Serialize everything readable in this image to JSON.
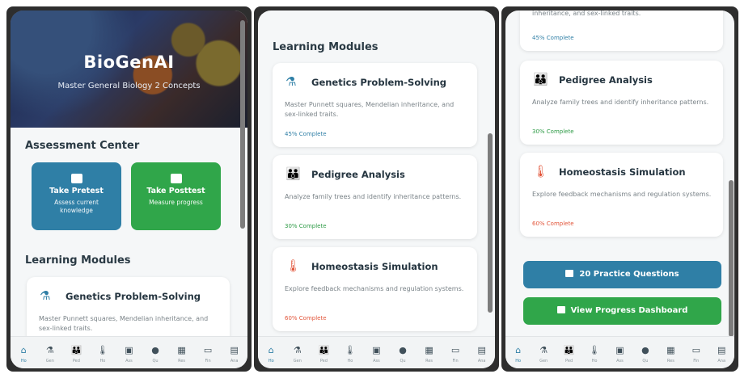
{
  "app": {
    "title": "BioGenAI",
    "subtitle": "Master General Biology 2 Concepts"
  },
  "assessment": {
    "section_title": "Assessment Center",
    "pretest": {
      "label": "Take Pretest",
      "desc": "Assess current knowledge"
    },
    "posttest": {
      "label": "Take Posttest",
      "desc": "Measure progress"
    }
  },
  "modules": {
    "section_title": "Learning Modules",
    "items": [
      {
        "icon": "microscope-icon",
        "title": "Genetics Problem-Solving",
        "desc": "Master Punnett squares, Mendelian inheritance, and sex-linked traits.",
        "progress": "45% Complete",
        "progress_value": 45,
        "color": "#2f7fa6"
      },
      {
        "icon": "family-icon",
        "title": "Pedigree Analysis",
        "desc": "Analyze family trees and identify inheritance patterns.",
        "progress": "30% Complete",
        "progress_value": 30,
        "color": "#2e9b46"
      },
      {
        "icon": "thermometer-icon",
        "title": "Homeostasis Simulation",
        "desc": "Explore feedback mechanisms and regulation systems.",
        "progress": "60% Complete",
        "progress_value": 60,
        "color": "#e2553a"
      }
    ],
    "partial_desc": "inheritance, and sex-linked traits."
  },
  "actions": {
    "practice": "20 Practice Questions",
    "dashboard": "View Progress Dashboard"
  },
  "nav": [
    {
      "icon": "home-icon",
      "label": "Ho"
    },
    {
      "icon": "microscope-icon",
      "label": "Gen"
    },
    {
      "icon": "family-icon",
      "label": "Ped"
    },
    {
      "icon": "thermometer-icon",
      "label": "Ho"
    },
    {
      "icon": "book-icon",
      "label": "Ass"
    },
    {
      "icon": "help-icon",
      "label": "Qu"
    },
    {
      "icon": "grid-icon",
      "label": "Res"
    },
    {
      "icon": "monitor-icon",
      "label": "Fin"
    },
    {
      "icon": "chart-icon",
      "label": "Ana"
    }
  ],
  "colors": {
    "primary": "#2f7fa6",
    "success": "#30a64a",
    "danger": "#e2553a"
  }
}
